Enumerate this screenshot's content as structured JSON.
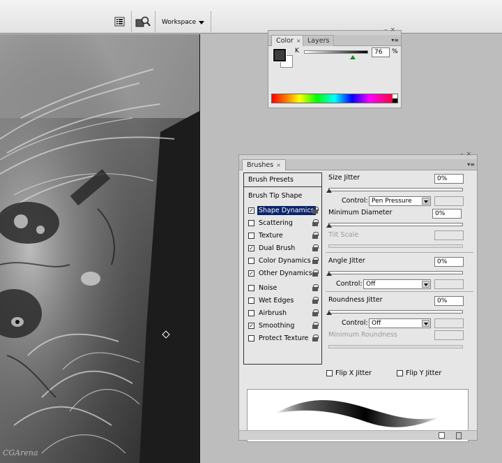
{
  "toolbar": {
    "workspace_label": "Workspace"
  },
  "canvas": {
    "watermark": "CGArena"
  },
  "color_panel": {
    "tabs": [
      {
        "label": "Color",
        "active": true
      },
      {
        "label": "Layers",
        "active": false
      }
    ],
    "channel_label": "K",
    "value": "76",
    "unit": "%",
    "foreground_color": "#3d3d3d",
    "background_color": "#ffffff",
    "slider_level": 0.76
  },
  "brushes_panel": {
    "tab_label": "Brushes",
    "presets_label": "Brush Presets",
    "tip_shape_label": "Brush Tip Shape",
    "items": [
      {
        "label": "Shape Dynamics",
        "checked": true,
        "selected": true
      },
      {
        "label": "Scattering",
        "checked": false
      },
      {
        "label": "Texture",
        "checked": false
      },
      {
        "label": "Dual Brush",
        "checked": true
      },
      {
        "label": "Color Dynamics",
        "checked": false
      },
      {
        "label": "Other Dynamics",
        "checked": true
      },
      {
        "label": "Noise",
        "checked": false
      },
      {
        "label": "Wet Edges",
        "checked": false
      },
      {
        "label": "Airbrush",
        "checked": false
      },
      {
        "label": "Smoothing",
        "checked": true
      },
      {
        "label": "Protect Texture",
        "checked": false
      }
    ],
    "size_jitter": {
      "label": "Size Jitter",
      "value": "0%"
    },
    "size_control": {
      "label": "Control:",
      "value": "Pen Pressure"
    },
    "minimum_diameter": {
      "label": "Minimum Diameter",
      "value": "0%"
    },
    "tilt_scale": {
      "label": "Tilt Scale"
    },
    "angle_jitter": {
      "label": "Angle Jitter",
      "value": "0%"
    },
    "angle_control": {
      "label": "Control:",
      "value": "Off"
    },
    "roundness_jitter": {
      "label": "Roundness Jitter",
      "value": "0%"
    },
    "roundness_control": {
      "label": "Control:",
      "value": "Off"
    },
    "minimum_roundness": {
      "label": "Minimum Roundness"
    },
    "flip_x": {
      "label": "Flip X Jitter",
      "checked": false
    },
    "flip_y": {
      "label": "Flip Y Jitter",
      "checked": false
    }
  }
}
